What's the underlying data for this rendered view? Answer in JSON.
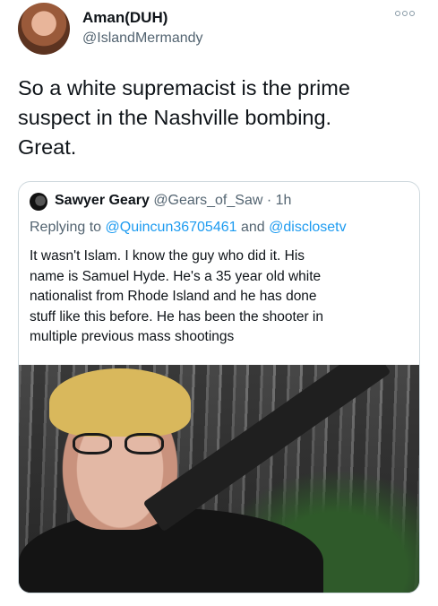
{
  "tweet": {
    "display_name": "Aman(DUH)",
    "handle": "@IslandMermandy",
    "text": "So a white supremacist is the prime\nsuspect in the Nashville bombing.\nGreat."
  },
  "quote": {
    "display_name": "Sawyer Geary",
    "handle": "@Gears_of_Saw",
    "separator": "·",
    "time": "1h",
    "replying_prefix": "Replying to ",
    "replying_user_1": "@Quincun36705461",
    "replying_and": " and ",
    "replying_user_2": "@disclosetv",
    "text": "It wasn't Islam. I know the guy who did it. His\nname is Samuel Hyde. He's a 35 year old white\nnationalist from Rhode Island and he has done\nstuff like this before. He has been the shooter in\nmultiple previous mass shootings"
  },
  "icons": {
    "more": "more-options-icon"
  },
  "colors": {
    "text": "#0f1419",
    "secondary": "#536471",
    "link": "#1d9bf0",
    "border": "#cfd9de"
  }
}
